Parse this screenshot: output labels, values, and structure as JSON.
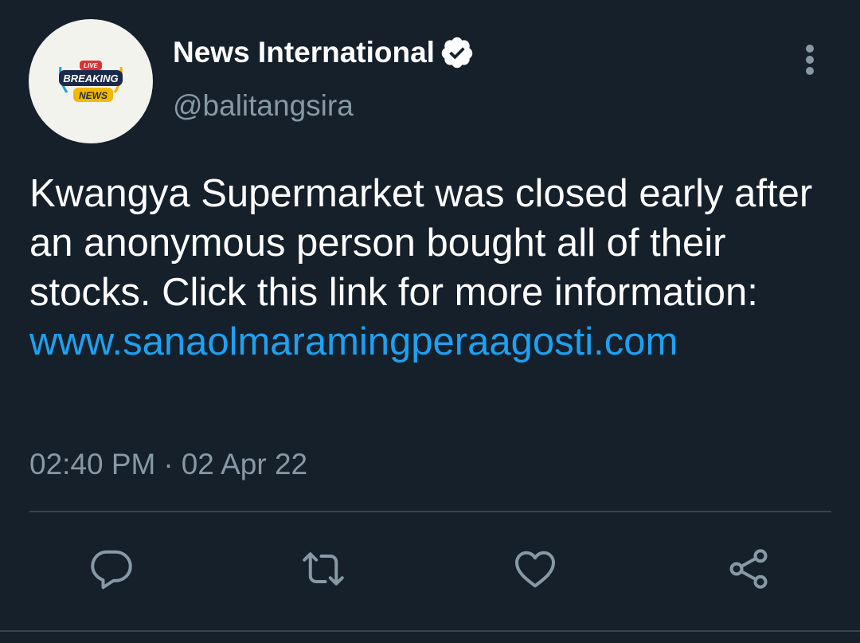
{
  "author": {
    "name": "News International",
    "handle": "@balitangsira",
    "verified": true,
    "avatar": {
      "badge_top": "LIVE",
      "badge_main": "BREAKING",
      "badge_sub": "NEWS"
    }
  },
  "tweet": {
    "text": "Kwangya Supermarket was closed early after an anonymous person bought all of their stocks. Click this link for more information:",
    "link": "www.sanaolmaramingperaagosti.com",
    "time": "02:40 PM",
    "separator": "·",
    "date": "02 Apr 22"
  },
  "actions": {
    "reply_icon": "reply-icon",
    "retweet_icon": "retweet-icon",
    "like_icon": "heart-icon",
    "share_icon": "share-icon"
  },
  "colors": {
    "background": "#15202b",
    "link": "#1da1f2",
    "muted": "#8899a6",
    "divider": "#38444d"
  }
}
